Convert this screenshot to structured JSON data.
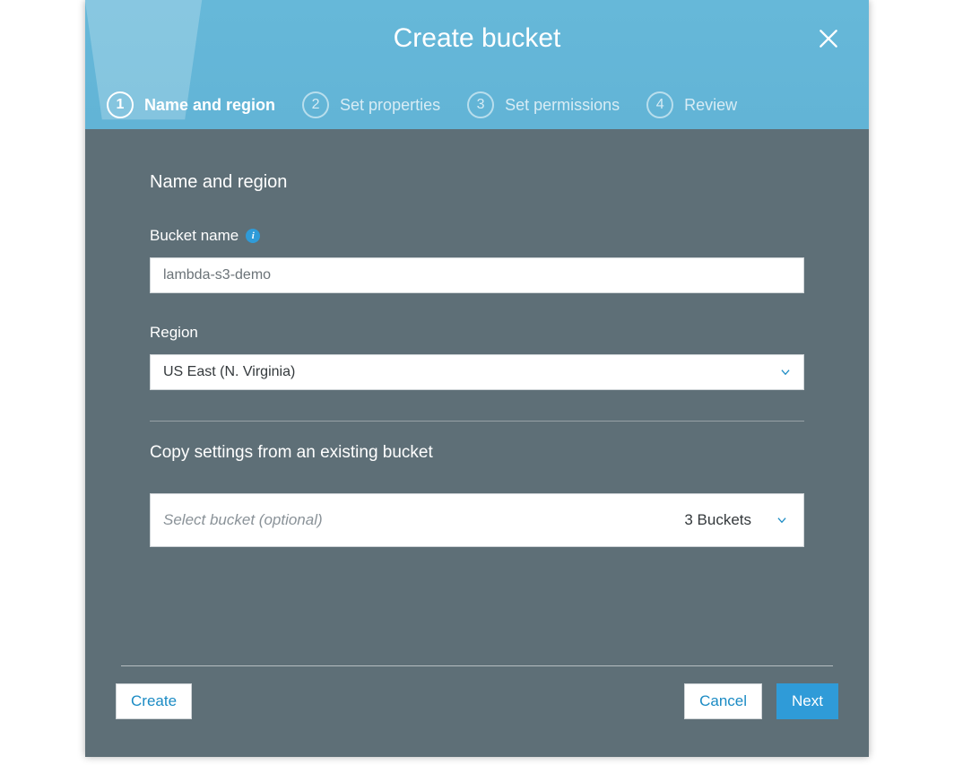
{
  "modal": {
    "title": "Create bucket"
  },
  "stepper": {
    "steps": [
      {
        "num": "1",
        "label": "Name and region"
      },
      {
        "num": "2",
        "label": "Set properties"
      },
      {
        "num": "3",
        "label": "Set permissions"
      },
      {
        "num": "4",
        "label": "Review"
      }
    ]
  },
  "body": {
    "section_title": "Name and region",
    "bucket_name_label": "Bucket name",
    "bucket_name_value": "lambda-s3-demo",
    "region_label": "Region",
    "region_selected": "US East (N. Virginia)",
    "copy_title": "Copy settings from an existing bucket",
    "copy_placeholder": "Select bucket (optional)",
    "copy_count": "3 Buckets"
  },
  "buttons": {
    "create": "Create",
    "cancel": "Cancel",
    "next": "Next"
  },
  "icons": {
    "info_char": "i"
  },
  "colors": {
    "header_bg": "#66b8d9",
    "accent": "#2f9bd8",
    "body_bg": "#5e6f77"
  }
}
